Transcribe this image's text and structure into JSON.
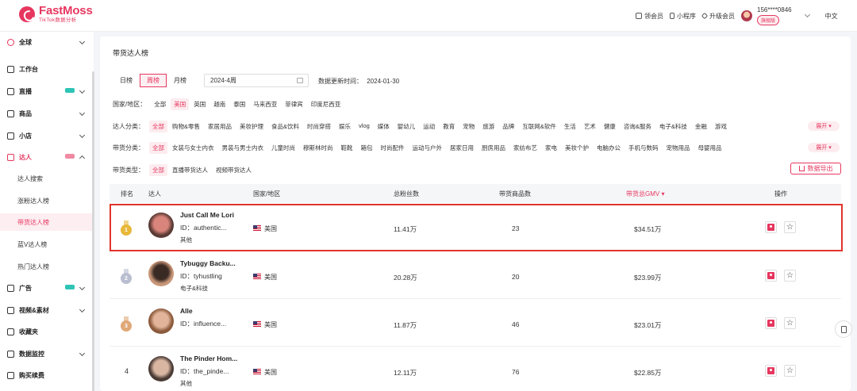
{
  "header": {
    "logo_name": "FastMoss",
    "logo_sub": "TikTok数据分析",
    "links": [
      {
        "label": "领会员",
        "icon": "crown-icon"
      },
      {
        "label": "小程序",
        "icon": "phone-icon"
      },
      {
        "label": "升级会员",
        "icon": "diamond-icon"
      }
    ],
    "phone": "156****0846",
    "plan_badge": "旗舰版",
    "language": "中文"
  },
  "sidebar": {
    "region": "全球",
    "items": [
      {
        "label": "工作台",
        "icon": "home-icon"
      },
      {
        "label": "直播",
        "icon": "live-icon",
        "tag": true
      },
      {
        "label": "商品",
        "icon": "goods-icon"
      },
      {
        "label": "小店",
        "icon": "shop-icon"
      },
      {
        "label": "达人",
        "icon": "star-person-icon",
        "tag": true
      }
    ],
    "sub_items": [
      "达人搜索",
      "涨粉达人榜",
      "带货达人榜",
      "蓝V达人榜",
      "热门达人榜"
    ],
    "items_bottom": [
      {
        "label": "广告",
        "icon": "ad-icon",
        "tag": true
      },
      {
        "label": "视频&素材",
        "icon": "video-icon"
      },
      {
        "label": "收藏夹",
        "icon": "bookmark-icon"
      },
      {
        "label": "数据监控",
        "icon": "monitor-icon"
      },
      {
        "label": "购买续费",
        "icon": "cart-icon"
      }
    ]
  },
  "page": {
    "title": "带货达人榜",
    "periods": [
      "日榜",
      "周榜",
      "月榜"
    ],
    "period_selected": "周榜",
    "date_value": "2024-4周",
    "update_label": "数据更新时间：",
    "update_value": "2024-01-30"
  },
  "filters": {
    "country": {
      "label": "国家/地区：",
      "options": [
        "全部",
        "美国",
        "英国",
        "越南",
        "泰国",
        "马来西亚",
        "菲律宾",
        "印度尼西亚"
      ],
      "selected": "美国"
    },
    "kol_category": {
      "label": "达人分类：",
      "options": [
        "全部",
        "购物&零售",
        "家居用品",
        "美妆护理",
        "食品&饮料",
        "时尚穿搭",
        "娱乐",
        "vlog",
        "媒体",
        "婴幼儿",
        "运动",
        "教育",
        "宠物",
        "旅游",
        "品牌",
        "互联网&软件",
        "生活",
        "艺术",
        "健康",
        "咨询&服务",
        "电子&科技",
        "金融",
        "游戏"
      ],
      "selected": "全部",
      "expand": "展开 ▾"
    },
    "goods_category": {
      "label": "带货分类：",
      "options": [
        "全部",
        "女装与女士内衣",
        "男装与男士内衣",
        "儿童时尚",
        "穆斯林时尚",
        "鞋靴",
        "箱包",
        "时尚配件",
        "运动与户外",
        "居家日用",
        "厨房用品",
        "家纺布艺",
        "家电",
        "美妆个护",
        "电脑办公",
        "手机与数码",
        "宠物用品",
        "母婴用品"
      ],
      "selected": "全部",
      "expand": "展开 ▾"
    },
    "sales_type": {
      "label": "带货类型：",
      "options": [
        "全部",
        "直播带货达人",
        "视频带货达人"
      ],
      "selected": "全部"
    },
    "export_label": "数据导出"
  },
  "table": {
    "columns": {
      "rank": "排名",
      "kol": "达人",
      "country": "国家/地区",
      "followers": "总粉丝数",
      "goods": "带货商品数",
      "gmv": "带货总GMV ▾",
      "ops": "操作"
    },
    "rows": [
      {
        "rank": "1",
        "name": "Just Call Me Lori",
        "id": "ID：authentic...",
        "category": "其他",
        "country": "美国",
        "followers": "11.41万",
        "goods": "23",
        "gmv": "$34.51万",
        "medal_color": "#e8b83a",
        "avatar_colors": [
          "#d9857b",
          "#5b3b35"
        ]
      },
      {
        "rank": "2",
        "name": "Tybuggy Backu...",
        "id": "ID：tyhustling",
        "category": "电子&科技",
        "country": "美国",
        "followers": "20.28万",
        "goods": "20",
        "gmv": "$23.99万",
        "medal_color": "#b9bed0",
        "avatar_colors": [
          "#3a2a24",
          "#c89678"
        ]
      },
      {
        "rank": "3",
        "name": "Alle",
        "id": "ID：influence...",
        "category": "",
        "country": "美国",
        "followers": "11.87万",
        "goods": "46",
        "gmv": "$23.01万",
        "medal_color": "#e0a878",
        "avatar_colors": [
          "#e2b59a",
          "#8c5a3c"
        ]
      },
      {
        "rank": "4",
        "name": "The Pinder Hom...",
        "id": "ID：the_pinde...",
        "category": "其他",
        "country": "美国",
        "followers": "12.11万",
        "goods": "76",
        "gmv": "$22.85万",
        "medal_color": "",
        "avatar_colors": [
          "#d8b6a2",
          "#4a3a34"
        ]
      }
    ]
  },
  "colors": {
    "brand": "#e6375f",
    "highlight_frame": "#e0342c"
  }
}
